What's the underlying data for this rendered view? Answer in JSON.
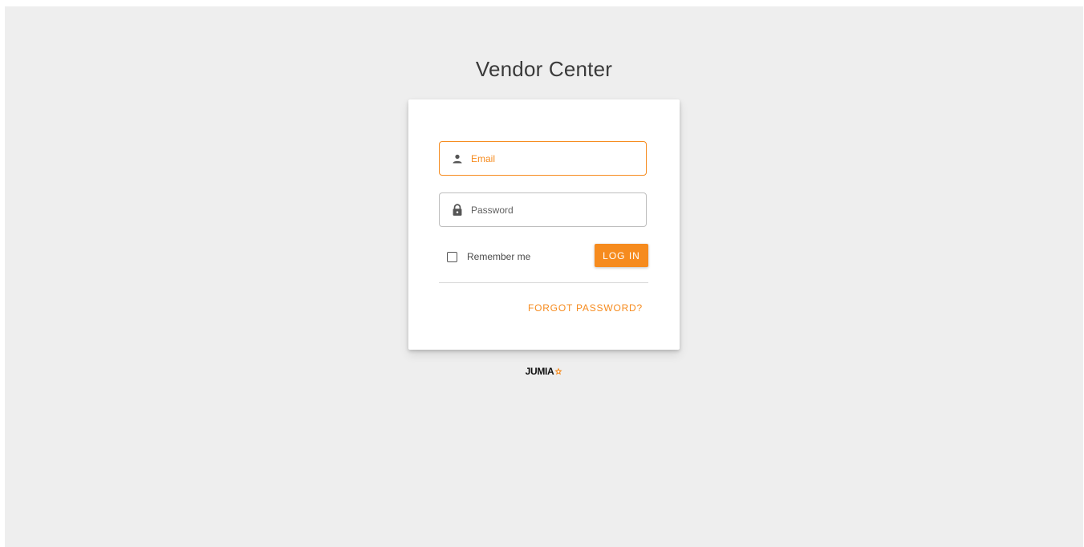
{
  "header": {
    "title": "Vendor Center"
  },
  "login_form": {
    "email": {
      "placeholder": "Email",
      "icon": "person-icon",
      "focused": true
    },
    "password": {
      "placeholder": "Password",
      "icon": "lock-icon"
    },
    "remember_me": {
      "label": "Remember me",
      "checked": false
    },
    "login_button": {
      "label": "LOG IN"
    },
    "forgot_password": {
      "label": "FORGOT PASSWORD?"
    }
  },
  "footer": {
    "logo_text": "JUMIA",
    "logo_icon": "star-icon"
  },
  "colors": {
    "accent": "#f68b1e",
    "background": "#eeeeee",
    "card": "#ffffff"
  }
}
